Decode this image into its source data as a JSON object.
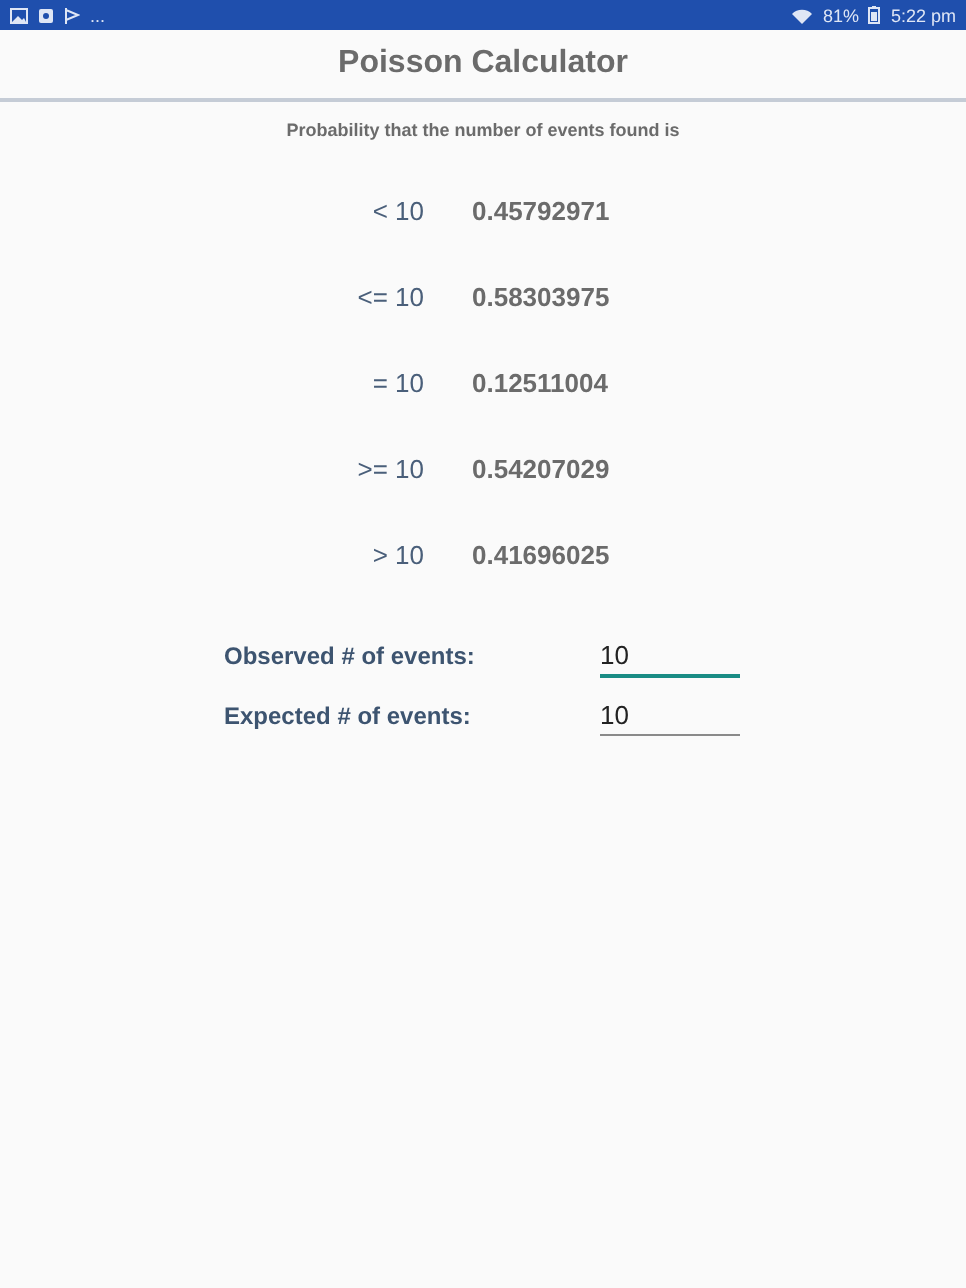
{
  "status_bar": {
    "notification_overflow": "...",
    "battery": "81%",
    "time": "5:22 pm"
  },
  "title": "Poisson Calculator",
  "subtitle": "Probability that the number of events found is",
  "results": [
    {
      "condition": "< 10",
      "probability": "0.45792971"
    },
    {
      "condition": "<= 10",
      "probability": "0.58303975"
    },
    {
      "condition": "= 10",
      "probability": "0.12511004"
    },
    {
      "condition": ">= 10",
      "probability": "0.54207029"
    },
    {
      "condition": "> 10",
      "probability": "0.41696025"
    }
  ],
  "inputs": [
    {
      "label": "Observed # of events:",
      "value": "10",
      "focused": true
    },
    {
      "label": "Expected # of events:",
      "value": "10",
      "focused": false
    }
  ]
}
